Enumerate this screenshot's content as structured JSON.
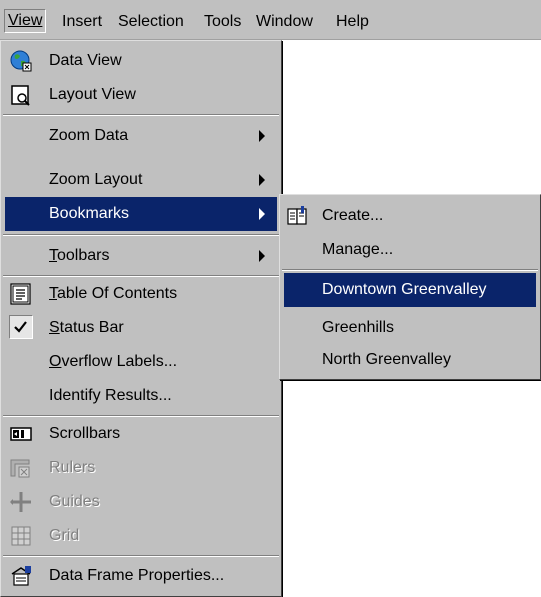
{
  "menubar": {
    "items": [
      {
        "label": "View"
      },
      {
        "label": "Insert"
      },
      {
        "label": "Selection"
      },
      {
        "label": "Tools"
      },
      {
        "label": "Window"
      },
      {
        "label": "Help"
      }
    ]
  },
  "view_menu": {
    "items": [
      {
        "label": "Data View",
        "icon": "globe-icon"
      },
      {
        "label": "Layout View",
        "icon": "layout-page-icon"
      },
      {
        "label": "Zoom Data",
        "submenu": true
      },
      {
        "label": "Zoom Layout",
        "submenu": true
      },
      {
        "label": "Bookmarks",
        "submenu": true,
        "highlighted": true
      },
      {
        "label": "Toolbars",
        "submenu": true
      },
      {
        "label": "Table Of Contents",
        "icon": "table-of-contents-icon"
      },
      {
        "label": "Status Bar",
        "checked": true
      },
      {
        "label": "Overflow Labels..."
      },
      {
        "label": "Identify Results..."
      },
      {
        "label": "Scrollbars",
        "icon": "scrollbars-icon"
      },
      {
        "label": "Rulers",
        "icon": "rulers-icon",
        "disabled": true
      },
      {
        "label": "Guides",
        "icon": "guides-icon",
        "disabled": true
      },
      {
        "label": "Grid",
        "icon": "grid-icon",
        "disabled": true
      },
      {
        "label": "Data Frame Properties...",
        "icon": "data-frame-properties-icon"
      }
    ]
  },
  "bookmarks_menu": {
    "items": [
      {
        "label": "Create...",
        "icon": "create-bookmark-icon"
      },
      {
        "label": "Manage..."
      },
      {
        "label": "Downtown Greenvalley",
        "highlighted": true
      },
      {
        "label": "Greenhills"
      },
      {
        "label": "North Greenvalley"
      }
    ]
  },
  "colors": {
    "menu_bg": "#c0c0c0",
    "highlight": "#0a246a",
    "highlight_text": "#ffffff",
    "disabled_text": "#808080"
  }
}
